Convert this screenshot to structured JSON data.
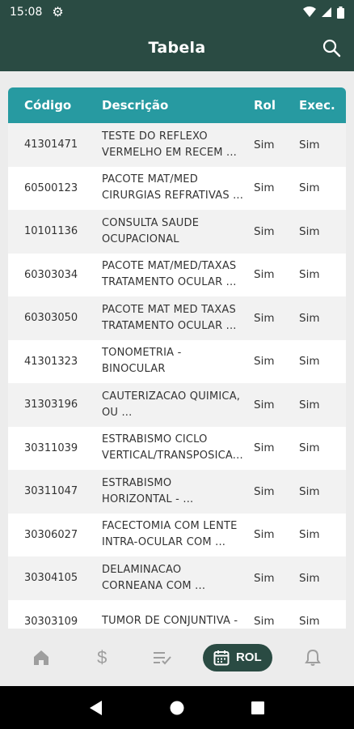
{
  "status_bar": {
    "time": "15:08"
  },
  "app_bar": {
    "title": "Tabela"
  },
  "table": {
    "headers": {
      "code": "Código",
      "description": "Descrição",
      "rol": "Rol",
      "exec": "Exec."
    },
    "rows": [
      {
        "code": "41301471",
        "desc1": "TESTE DO REFLEXO",
        "desc2": "VERMELHO EM RECEM ...",
        "rol": "Sim",
        "exec": "Sim"
      },
      {
        "code": "60500123",
        "desc1": "PACOTE MAT/MED",
        "desc2": "CIRURGIAS REFRATIVAS ...",
        "rol": "Sim",
        "exec": "Sim"
      },
      {
        "code": "10101136",
        "desc1": "CONSULTA SAUDE",
        "desc2": "OCUPACIONAL",
        "rol": "Sim",
        "exec": "Sim"
      },
      {
        "code": "60303034",
        "desc1": "PACOTE MAT/MED/TAXAS",
        "desc2": "TRATAMENTO OCULAR ...",
        "rol": "Sim",
        "exec": "Sim"
      },
      {
        "code": "60303050",
        "desc1": "PACOTE MAT MED TAXAS",
        "desc2": "TRATAMENTO OCULAR ...",
        "rol": "Sim",
        "exec": "Sim"
      },
      {
        "code": "41301323",
        "desc1": "TONOMETRIA -",
        "desc2": "BINOCULAR",
        "rol": "Sim",
        "exec": "Sim"
      },
      {
        "code": "31303196",
        "desc1": "CAUTERIZACAO QUIMICA,",
        "desc2": "OU ...",
        "rol": "Sim",
        "exec": "Sim"
      },
      {
        "code": "30311039",
        "desc1": "ESTRABISMO CICLO",
        "desc2": "VERTICAL/TRANSPOSICA...",
        "rol": "Sim",
        "exec": "Sim"
      },
      {
        "code": "30311047",
        "desc1": "ESTRABISMO",
        "desc2": "HORIZONTAL - ...",
        "rol": "Sim",
        "exec": "Sim"
      },
      {
        "code": "30306027",
        "desc1": "FACECTOMIA COM LENTE",
        "desc2": "INTRA-OCULAR COM ...",
        "rol": "Sim",
        "exec": "Sim"
      },
      {
        "code": "30304105",
        "desc1": "DELAMINACAO",
        "desc2": "CORNEANA COM ...",
        "rol": "Sim",
        "exec": "Sim"
      },
      {
        "code": "30303109",
        "desc1": "TUMOR DE CONJUNTIVA -",
        "desc2": "",
        "rol": "Sim",
        "exec": "Sim"
      }
    ]
  },
  "bottom_nav": {
    "items": [
      {
        "icon": "home-icon"
      },
      {
        "icon": "dollar-icon"
      },
      {
        "icon": "checklist-icon"
      },
      {
        "icon": "calendar-icon",
        "label": "ROL",
        "active": true
      },
      {
        "icon": "bell-icon"
      }
    ]
  },
  "colors": {
    "primary": "#2a4b43",
    "header": "#279aa1"
  }
}
